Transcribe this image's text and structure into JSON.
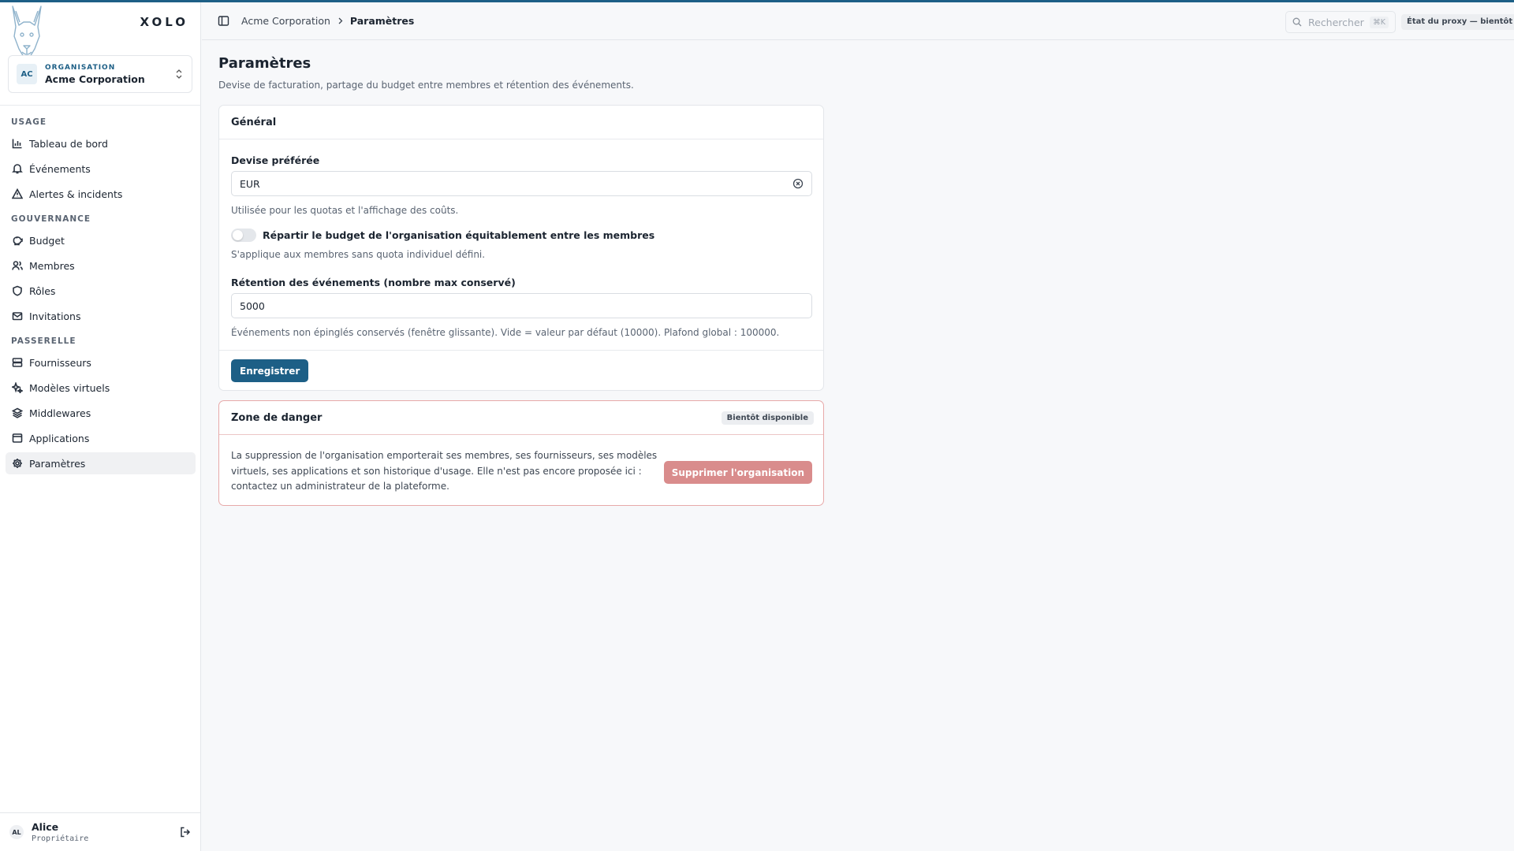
{
  "brand": {
    "name": "XOLO",
    "logo_icon": "dog-head-logo"
  },
  "org_switcher": {
    "avatar": "AC",
    "kicker": "ORGANISATION",
    "name": "Acme Corporation"
  },
  "nav": {
    "sections": [
      {
        "title": "USAGE",
        "items": [
          {
            "label": "Tableau de bord",
            "icon": "bar-chart-icon"
          },
          {
            "label": "Événements",
            "icon": "bell-icon"
          },
          {
            "label": "Alertes & incidents",
            "icon": "warning-icon"
          }
        ]
      },
      {
        "title": "GOUVERNANCE",
        "items": [
          {
            "label": "Budget",
            "icon": "piggy-bank-icon"
          },
          {
            "label": "Membres",
            "icon": "users-icon"
          },
          {
            "label": "Rôles",
            "icon": "shield-icon"
          },
          {
            "label": "Invitations",
            "icon": "mail-icon"
          }
        ]
      },
      {
        "title": "PASSERELLE",
        "items": [
          {
            "label": "Fournisseurs",
            "icon": "server-icon"
          },
          {
            "label": "Modèles virtuels",
            "icon": "sparkles-icon"
          },
          {
            "label": "Middlewares",
            "icon": "layers-icon"
          },
          {
            "label": "Applications",
            "icon": "window-icon"
          },
          {
            "label": "Paramètres",
            "icon": "gear-icon",
            "active": true
          }
        ]
      }
    ]
  },
  "user": {
    "initials": "AL",
    "name": "Alice",
    "role": "Propriétaire"
  },
  "topbar": {
    "breadcrumb": {
      "parent": "Acme Corporation",
      "current": "Paramètres"
    },
    "search": {
      "placeholder": "Rechercher",
      "shortcut": "⌘K"
    },
    "proxy_status": "État du proxy — bientôt"
  },
  "page": {
    "title": "Paramètres",
    "description": "Devise de facturation, partage du budget entre membres et rétention des événements."
  },
  "general": {
    "title": "Général",
    "currency_label": "Devise préférée",
    "currency_value": "EUR",
    "currency_hint": "Utilisée pour les quotas et l'affichage des coûts.",
    "split_label": "Répartir le budget de l'organisation équitablement entre les membres",
    "split_enabled": false,
    "split_hint": "S'applique aux membres sans quota individuel défini.",
    "retention_label": "Rétention des événements (nombre max conservé)",
    "retention_value": "5000",
    "retention_hint": "Événements non épinglés conservés (fenêtre glissante). Vide = valeur par défaut (10000). Plafond global : 100000.",
    "save_label": "Enregistrer"
  },
  "danger": {
    "title": "Zone de danger",
    "badge": "Bientôt disponible",
    "text": "La suppression de l'organisation emporterait ses membres, ses fournisseurs, ses modèles virtuels, ses applications et son historique d'usage. Elle n'est pas encore proposée ici : contactez un administrateur de la plateforme.",
    "delete_label": "Supprimer l'organisation"
  },
  "colors": {
    "accent": "#1d5f86",
    "danger": "#d98c8c",
    "danger_border": "#e7a9a9"
  }
}
